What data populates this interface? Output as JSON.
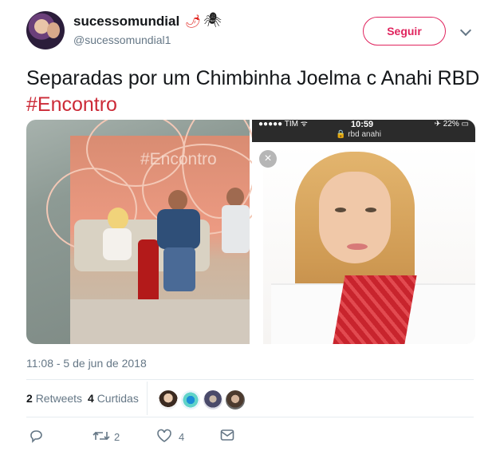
{
  "tweet": {
    "author": {
      "display_name": "sucessomundial",
      "emoji_1": "🌶",
      "emoji_2": "🕷",
      "handle": "@sucessomundial1",
      "avatar_icon": "profile-photo"
    },
    "follow_button_label": "Seguir",
    "text_plain": "Separadas por um Chimbinha  Joelma c Anahi RBD ",
    "hashtag": "#Encontro",
    "media": {
      "left_image": {
        "tv_hashtag": "#Encontro"
      },
      "right_image": {
        "status_bar_left": "●●●●● TIM ᯤ",
        "status_bar_time": "10:59",
        "status_bar_right": "✈ 22% ▭",
        "status_bar_url": "🔒 rbd anahi",
        "close_glyph": "×"
      }
    },
    "timestamp": "11:08 - 5 de jun de 2018",
    "stats": {
      "retweets_count": "2",
      "retweets_label": "Retweets",
      "likes_count": "4",
      "likes_label": "Curtidas"
    },
    "actions": {
      "reply_icon": "reply-icon",
      "retweet_icon": "retweet-icon",
      "retweet_count": "2",
      "like_icon": "heart-icon",
      "like_count": "4",
      "dm_icon": "envelope-icon"
    },
    "colors": {
      "follow": "#e0245e",
      "hashtag": "#cc2a37",
      "secondary_text": "#657786"
    }
  }
}
